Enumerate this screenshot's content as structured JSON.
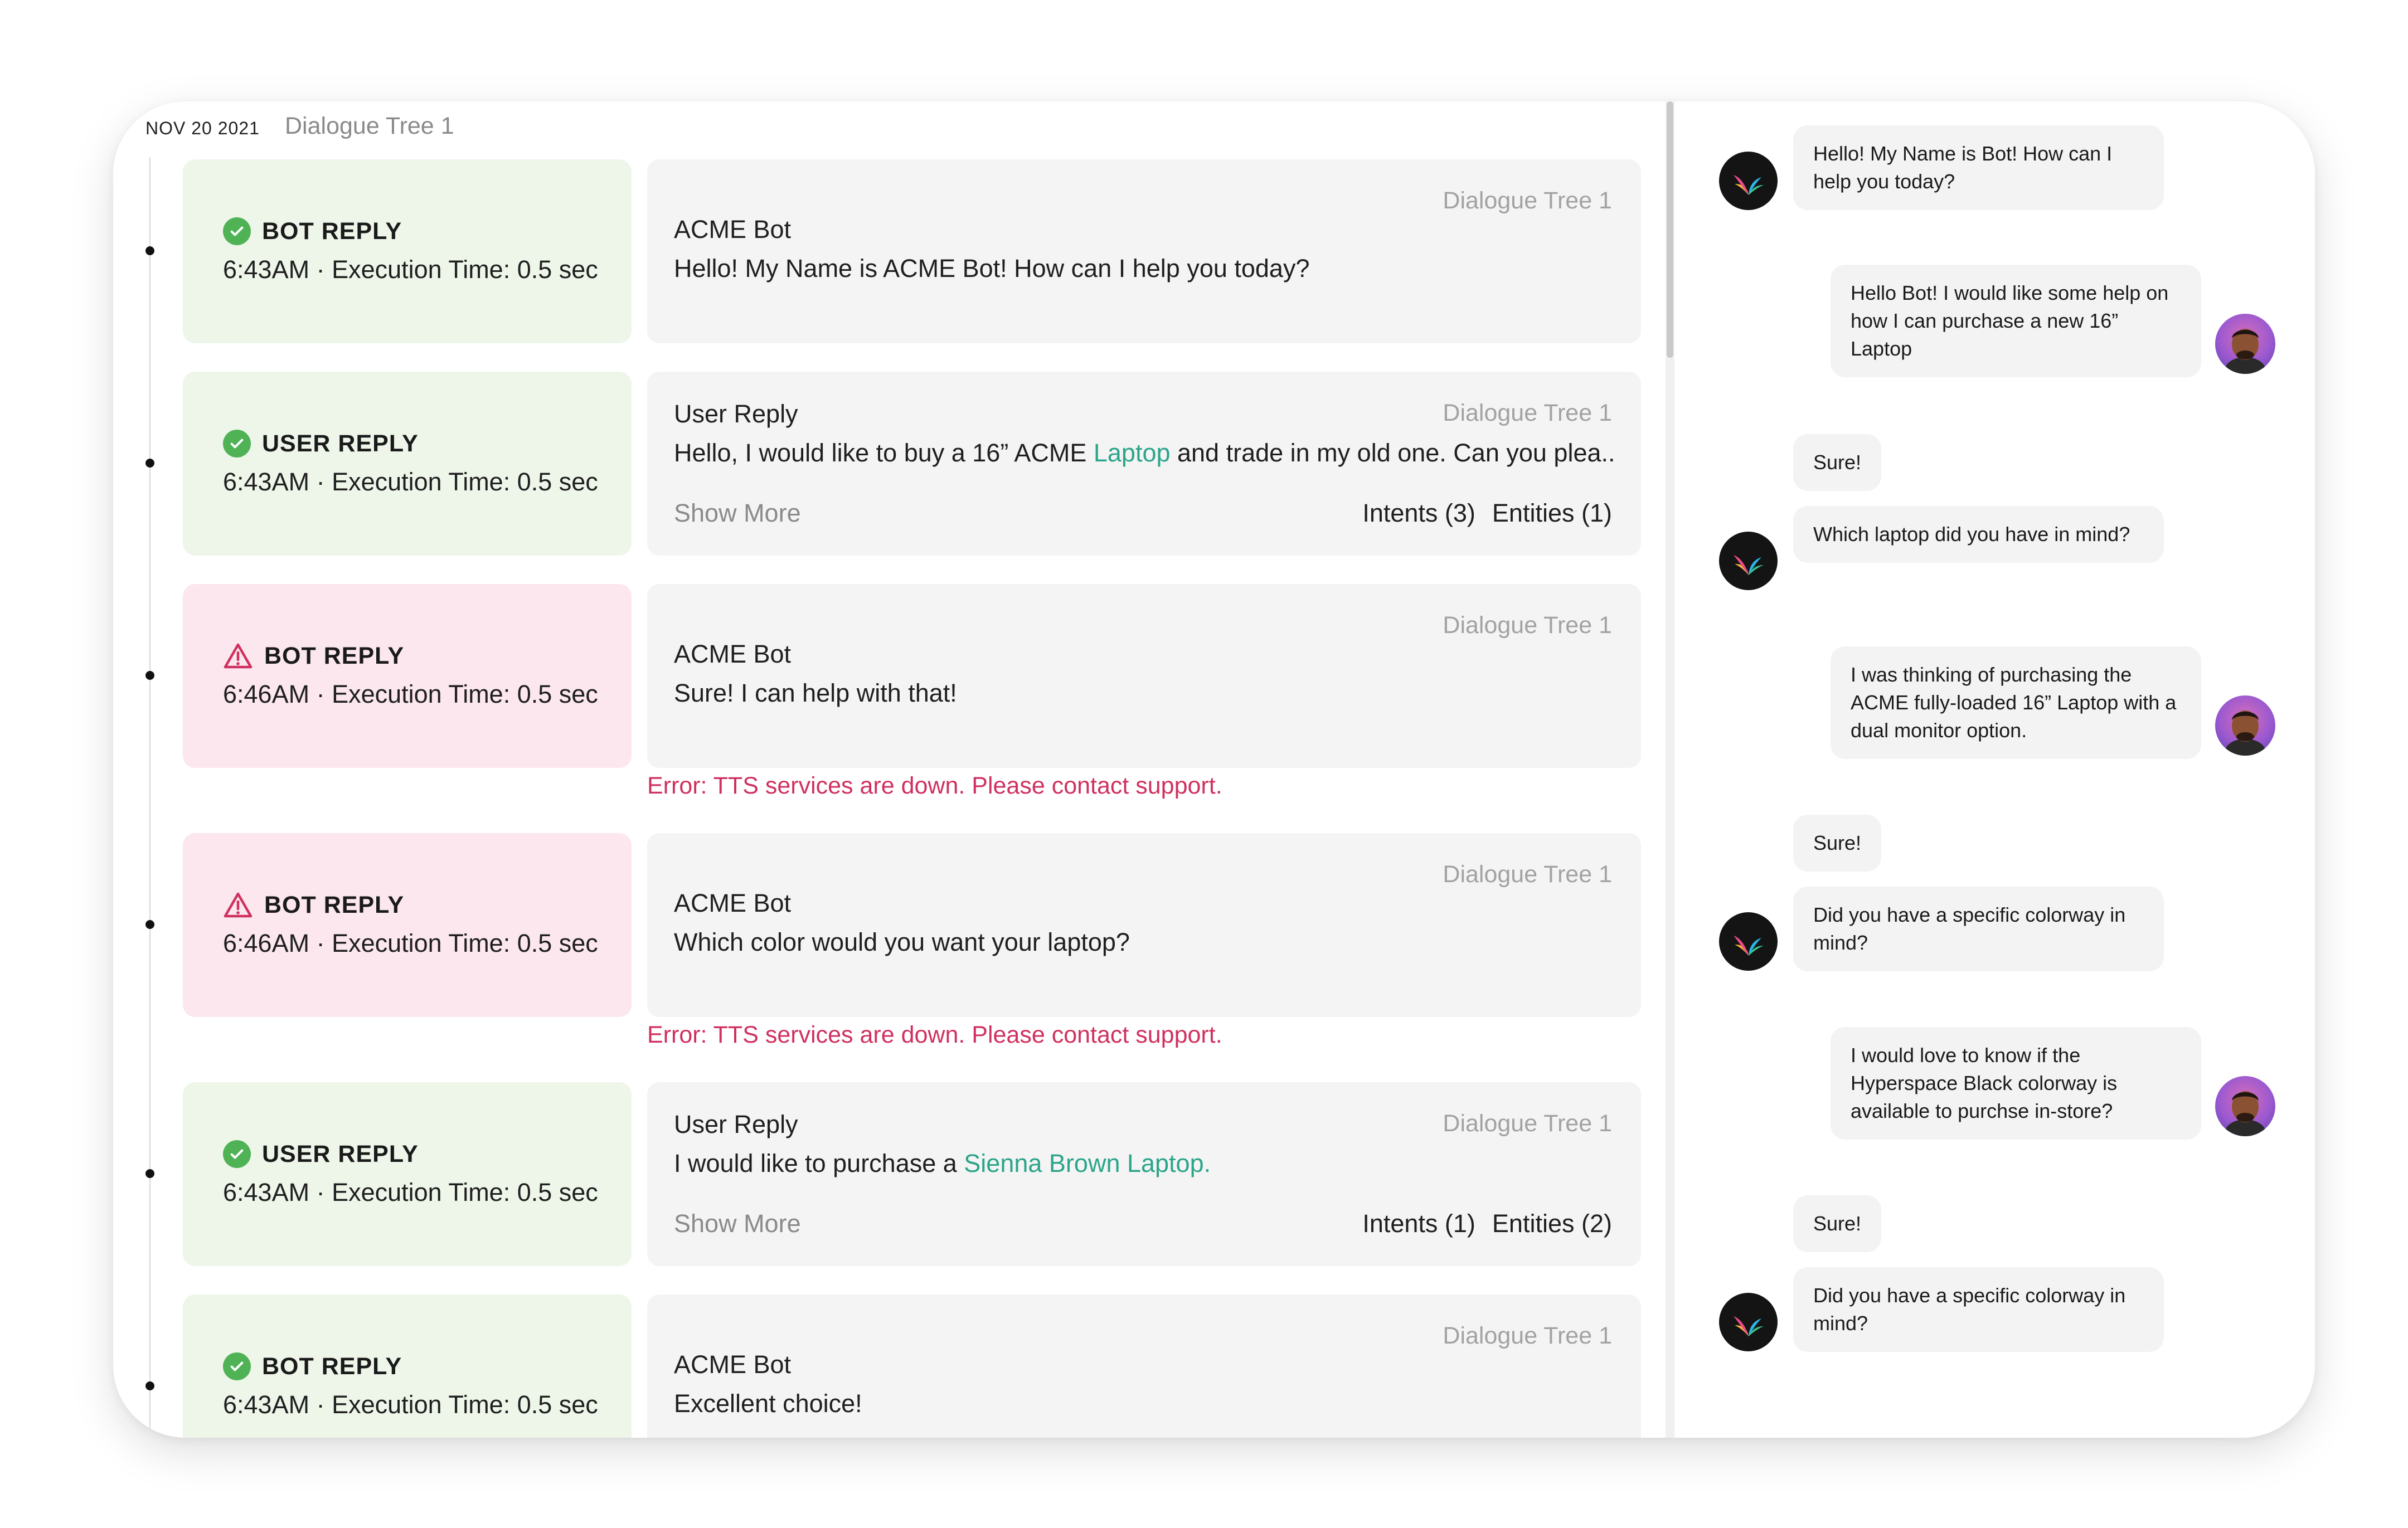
{
  "header": {
    "date": "NOV 20 2021",
    "tree": "Dialogue Tree 1"
  },
  "timeline": [
    {
      "status": "ok",
      "type": "BOT REPLY",
      "meta": "6:43AM · Execution Time: 0.5 sec",
      "tree": "Dialogue Tree 1",
      "author": "ACME Bot",
      "text_before": "Hello! My Name is ACME Bot! How can I help you today?",
      "highlight": "",
      "text_after": ""
    },
    {
      "status": "ok",
      "type": "USER REPLY",
      "meta": "6:43AM · Execution Time: 0.5 sec",
      "tree": "Dialogue Tree 1",
      "author": "User Reply",
      "text_before": "Hello, I would like to buy a 16” ACME ",
      "highlight": "Laptop",
      "text_after": " and trade in my old one. Can you plea...",
      "show_more": "Show More",
      "intents": "Intents (3)",
      "entities": "Entities (1)"
    },
    {
      "status": "err",
      "type": "BOT REPLY",
      "meta": "6:46AM · Execution Time: 0.5 sec",
      "tree": "Dialogue Tree 1",
      "author": "ACME Bot",
      "text_before": "Sure! I can help with that!",
      "highlight": "",
      "text_after": "",
      "error": "Error: TTS services are down. Please contact support."
    },
    {
      "status": "err",
      "type": "BOT REPLY",
      "meta": "6:46AM · Execution Time: 0.5 sec",
      "tree": "Dialogue Tree 1",
      "author": "ACME Bot",
      "text_before": "Which color would you want your laptop?",
      "highlight": "",
      "text_after": "",
      "error": "Error: TTS services are down. Please contact support."
    },
    {
      "status": "ok",
      "type": "USER REPLY",
      "meta": "6:43AM · Execution Time: 0.5 sec",
      "tree": "Dialogue Tree 1",
      "author": "User Reply",
      "text_before": "I would like to purchase a ",
      "highlight": "Sienna Brown Laptop.",
      "text_after": "",
      "show_more": "Show More",
      "intents": "Intents (1)",
      "entities": "Entities (2)"
    },
    {
      "status": "ok",
      "type": "BOT REPLY",
      "meta": "6:43AM · Execution Time: 0.5 sec",
      "tree": "Dialogue Tree 1",
      "author": "ACME Bot",
      "text_before": "Excellent choice!",
      "highlight": "",
      "text_after": ""
    }
  ],
  "chat": [
    {
      "from": "bot",
      "text": "Hello! My Name is Bot! How can I help you today?"
    },
    {
      "from": "user",
      "text": "Hello Bot! I would like some help on how I can purchase a new 16” Laptop"
    },
    {
      "from": "bot-short",
      "text": "Sure!"
    },
    {
      "from": "bot",
      "text": "Which laptop did you have in mind?"
    },
    {
      "from": "user",
      "text": "I was thinking of purchasing the ACME fully-loaded 16” Laptop with a dual monitor option."
    },
    {
      "from": "bot-short",
      "text": "Sure!"
    },
    {
      "from": "bot",
      "text": "Did you have a specific colorway in mind?"
    },
    {
      "from": "user",
      "text": "I would love to know if the Hyperspace Black colorway is available to purchse in-store?"
    },
    {
      "from": "bot-short",
      "text": "Sure!"
    },
    {
      "from": "bot",
      "text": "Did you have a specific colorway in mind?"
    }
  ],
  "colors": {
    "accent": "#2ba58a",
    "ok_bg": "#eef6ea",
    "err_bg": "#fbe7ed",
    "error_text": "#d0305f",
    "check": "#4fb356"
  },
  "icons": {
    "ok": "check-circle-icon",
    "err": "warning-triangle-icon",
    "bot": "bot-logo-icon",
    "user": "user-avatar"
  }
}
